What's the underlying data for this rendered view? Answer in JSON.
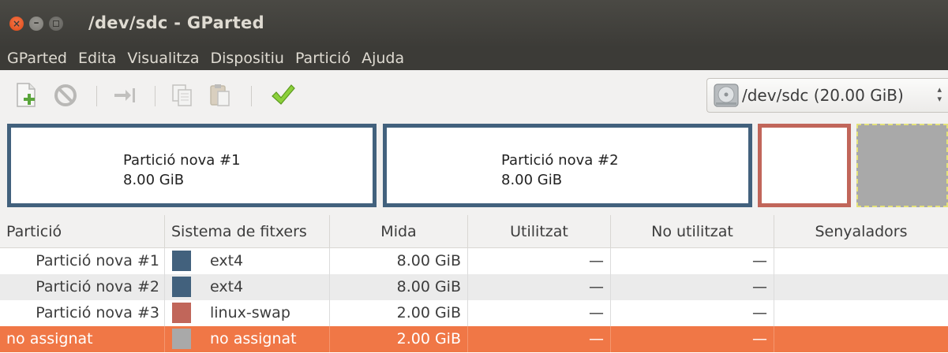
{
  "window": {
    "title": "/dev/sdc - GParted",
    "buttons": [
      "close-icon",
      "minimize-icon",
      "maximize-icon"
    ]
  },
  "menu": [
    "GParted",
    "Edita",
    "Visualitza",
    "Dispositiu",
    "Partició",
    "Ajuda"
  ],
  "toolbar": {
    "icons": [
      "new-partition-icon",
      "delete-icon",
      "resize-move-icon",
      "copy-icon",
      "paste-icon",
      "apply-icon"
    ],
    "device": {
      "label": "/dev/sdc  (20.00 GiB)",
      "icon": "hard-disk-icon"
    }
  },
  "graphic": {
    "partitions": [
      {
        "name": "Partició nova #1",
        "size": "8.00 GiB",
        "color": "#42617d"
      },
      {
        "name": "Partició nova #2",
        "size": "8.00 GiB",
        "color": "#42617d"
      },
      {
        "name": "",
        "size": "",
        "color": "#c1665a"
      },
      {
        "name": "",
        "size": "",
        "color": "#a9a9a9"
      }
    ]
  },
  "table": {
    "headers": [
      "Partició",
      "Sistema de fitxers",
      "Mida",
      "Utilitzat",
      "No utilitzat",
      "Senyaladors"
    ],
    "rows": [
      {
        "partition": "Partició nova #1",
        "fs": "ext4",
        "fs_color": "#42617d",
        "size": "8.00 GiB",
        "used": "—",
        "unused": "—",
        "flags": ""
      },
      {
        "partition": "Partició nova #2",
        "fs": "ext4",
        "fs_color": "#42617d",
        "size": "8.00 GiB",
        "used": "—",
        "unused": "—",
        "flags": ""
      },
      {
        "partition": "Partició nova #3",
        "fs": "linux-swap",
        "fs_color": "#c1665a",
        "size": "2.00 GiB",
        "used": "—",
        "unused": "—",
        "flags": ""
      },
      {
        "partition": "no assignat",
        "fs": "no assignat",
        "fs_color": "#a9a9a9",
        "size": "2.00 GiB",
        "used": "—",
        "unused": "—",
        "flags": ""
      }
    ],
    "selected_row": 3,
    "selection_color": "#f07746"
  }
}
